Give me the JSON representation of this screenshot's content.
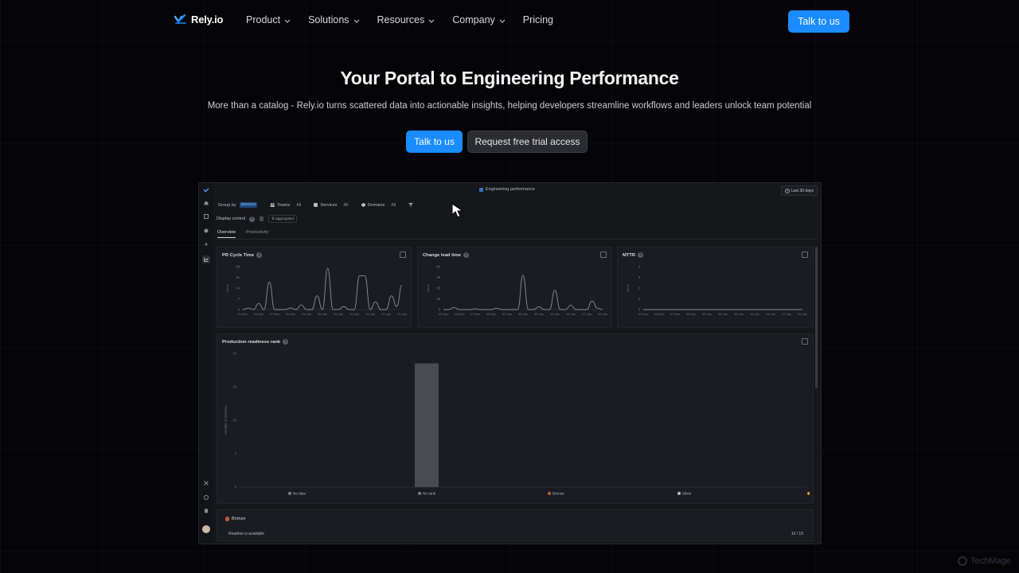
{
  "brand": {
    "name": "Rely.io",
    "accent": "#1a8cff"
  },
  "nav": {
    "items": [
      {
        "label": "Product",
        "dropdown": true
      },
      {
        "label": "Solutions",
        "dropdown": true
      },
      {
        "label": "Resources",
        "dropdown": true
      },
      {
        "label": "Company",
        "dropdown": true
      },
      {
        "label": "Pricing",
        "dropdown": false
      }
    ],
    "cta": "Talk to us"
  },
  "hero": {
    "title": "Your Portal to Engineering Performance",
    "subtitle": "More than a catalog - Rely.io turns scattered data into actionable insights, helping developers streamline workflows and leaders unlock team potential",
    "cta_primary": "Talk to us",
    "cta_secondary": "Request free trial access"
  },
  "app": {
    "title": "Engineering performance",
    "range": "Last 30 days",
    "filters": {
      "group_by_label": "Group by",
      "group_by_value": "Services",
      "teams": "Teams",
      "teams_value": "All",
      "services": "Services",
      "services_value": "All",
      "domains": "Domains",
      "domains_value": "All"
    },
    "display_control": "Display control",
    "aggregated": "aggregated",
    "tabs": [
      {
        "label": "Overview",
        "active": true
      },
      {
        "label": "Productivity",
        "active": false
      }
    ],
    "cards": {
      "pr_cycle": "PR Cycle Time",
      "change_lead": "Change lead time",
      "mttr": "MTTR",
      "readiness": "Production readiness rank"
    },
    "bottom": {
      "badge": "Bronze",
      "text": "Readme is available",
      "count": "10 / 15"
    }
  },
  "chart_data": [
    {
      "type": "line",
      "title": "PR Cycle Time",
      "ylabel": "hours",
      "yticks": [
        "28",
        "21",
        "14",
        "7",
        "0"
      ],
      "ylim": [
        0,
        28
      ],
      "xticks": [
        "21 Dec",
        "24 Dec",
        "27 Dec",
        "30 Dec",
        "03 Jan",
        "06 Jan",
        "09 Jan",
        "11 Jan",
        "14 Jan",
        "17 Jan",
        "20 Jan"
      ],
      "x": [
        0,
        1,
        2,
        3,
        4,
        5,
        6,
        7,
        8,
        9,
        10,
        11,
        12,
        13,
        14,
        15,
        16,
        17,
        18,
        19,
        20,
        21,
        22,
        23,
        24,
        25,
        26,
        27,
        28,
        29,
        30
      ],
      "values": [
        0,
        1,
        0,
        4,
        0,
        18,
        0,
        0,
        0,
        1,
        0,
        3,
        0,
        0,
        9,
        0,
        27,
        0,
        0,
        2,
        0,
        0,
        22,
        22,
        0,
        5,
        0,
        0,
        9,
        2,
        16
      ]
    },
    {
      "type": "line",
      "title": "Change lead time",
      "ylabel": "hours",
      "yticks": [
        "60",
        "45",
        "30",
        "15",
        "0"
      ],
      "ylim": [
        0,
        60
      ],
      "xticks": [
        "21 Dec",
        "24 Dec",
        "27 Dec",
        "30 Dec",
        "03 Jan",
        "06 Jan",
        "09 Jan",
        "11 Jan",
        "14 Jan",
        "17 Jan",
        "20 Jan"
      ],
      "x": [
        0,
        1,
        2,
        3,
        4,
        5,
        6,
        7,
        8,
        9,
        10,
        11,
        12,
        13,
        14,
        15,
        16,
        17,
        18,
        19,
        20,
        21,
        22,
        23,
        24,
        25,
        26,
        27,
        28,
        29,
        30
      ],
      "values": [
        0,
        0,
        3,
        0,
        0,
        0,
        1,
        0,
        0,
        0,
        2,
        0,
        0,
        0,
        0,
        48,
        0,
        0,
        4,
        0,
        0,
        27,
        0,
        0,
        6,
        0,
        0,
        0,
        12,
        2,
        0
      ]
    },
    {
      "type": "line",
      "title": "MTTR",
      "ylabel": "hours",
      "yticks": [
        "4",
        "3",
        "2",
        "1",
        "0"
      ],
      "ylim": [
        0,
        4
      ],
      "xticks": [
        "21 Dec",
        "24 Dec",
        "27 Dec",
        "30 Dec",
        "03 Jan",
        "06 Jan",
        "09 Jan",
        "11 Jan",
        "14 Jan",
        "17 Jan",
        "20 Jan"
      ],
      "x": [
        0,
        1,
        2,
        3,
        4,
        5,
        6,
        7,
        8,
        9,
        10,
        11,
        12,
        13,
        14,
        15,
        16,
        17,
        18,
        19,
        20,
        21,
        22,
        23,
        24,
        25,
        26,
        27,
        28,
        29,
        30
      ],
      "values": [
        0,
        0,
        0,
        0,
        0,
        0,
        0,
        0,
        0,
        0,
        0,
        0,
        0,
        0,
        0,
        0,
        0,
        0,
        0,
        0,
        0,
        0,
        0,
        0,
        0,
        0,
        0,
        0,
        0,
        0,
        0
      ]
    },
    {
      "type": "bar",
      "title": "Production readiness rank",
      "ylabel": "Number of services",
      "yticks": [
        "20",
        "15",
        "10",
        "5",
        "0"
      ],
      "ylim": [
        0,
        20
      ],
      "categories": [
        "No data",
        "No rank",
        "Bronze",
        "Silver",
        "Gold"
      ],
      "values": [
        0,
        18.5,
        0,
        0,
        0
      ],
      "colors": {
        "bar": "#4a4b50",
        "bronze": "#c0603a",
        "silver": "#b9bcc4",
        "gold": "#d4a02a"
      }
    }
  ],
  "watermark": "TechMage"
}
